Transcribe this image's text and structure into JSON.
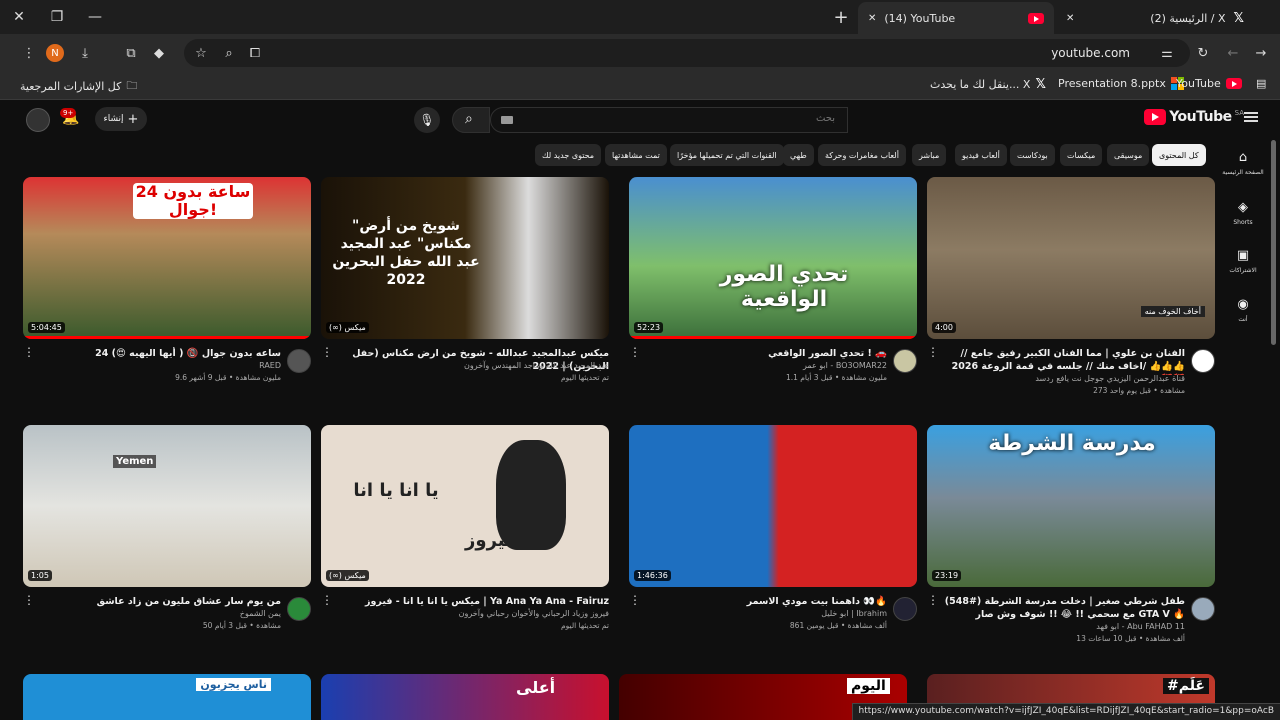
{
  "browser": {
    "tabs": [
      {
        "title": "(14) YouTube"
      },
      {
        "title": "(2) الرئيسية / X"
      }
    ],
    "url": "youtube.com",
    "profile_initial": "N",
    "bookmarks": [
      {
        "label": "YouTube"
      },
      {
        "label": "Presentation 8.pptx"
      },
      {
        "label": "ينقل لك ما يحدث... X"
      },
      {
        "label": "كل الإشارات المرجعية"
      }
    ],
    "status_url": "https://www.youtube.com/watch?v=ijfJZI_40qE&list=RDijfJZI_40qE&start_radio=1&pp=oAcB"
  },
  "youtube": {
    "region": "SA",
    "logo_text": "YouTube",
    "search_placeholder": "بحث",
    "create_label": "إنشاء",
    "notif_count": "9+",
    "chips": [
      "كل المحتوى",
      "موسيقى",
      "ميكسات",
      "بودكاست",
      "ألعاب فيديو",
      "مباشر",
      "ألعاب مغامرات وحركة",
      "طهي",
      "القنوات التي تم تحميلها مؤخرًا",
      "تمت مشاهدتها",
      "محتوى جديد لك"
    ],
    "sidebar": [
      {
        "label": "الصفحة الرئيسية",
        "icon": "home-icon"
      },
      {
        "label": "Shorts",
        "icon": "shorts-icon"
      },
      {
        "label": "الاشتراكات",
        "icon": "subscriptions-icon"
      },
      {
        "label": "أنت",
        "icon": "you-icon"
      }
    ],
    "videos": [
      {
        "title": "الفنان بن علوي | مما الفنان الكبير رفيق جامع // اخاف منك // جلسه في قمة الروعة 2026/ 👍👍👍 💯💯",
        "channel": "قناة عبدالرحمن اليزيدي جوجل نت يافع ردسد",
        "stats": "273 مشاهدة • قبل يوم واحد",
        "duration": "4:00",
        "overlay": "أخاف الخوف منه",
        "progress": 0
      },
      {
        "title": "تحدي الصور الواقعي ! 🚗",
        "channel": "ابو عمر - BO3OMAR22",
        "stats": "1.1 مليون مشاهدة • قبل 3 أيام",
        "duration": "52:23",
        "overlay": "تحدي الصور الواقعية",
        "progress": 1
      },
      {
        "title": "ميكس عبدالمجيد عبدالله - شويخ من ارض مكناس (حفل البحرين) | 2022",
        "channel": "عبد المجيد عبد الله وماجد المهندس وآخرون",
        "stats": "تم تحديثها اليوم",
        "duration": "(∞) ميكس",
        "overlay": "\"شويخ من أرض مكناس\" عبد المجيد عبد الله حفل البحرين 2022",
        "progress": 0
      },
      {
        "title": "24 ساعه بدون جوال 📵 ( أيها اليهيه 😍)",
        "channel": "RAED",
        "stats": "9.6 مليون مشاهدة • قبل 9 أشهر",
        "duration": "5:04:45",
        "overlay": "24 ساعة بدون جوال!",
        "progress": 1
      },
      {
        "title": "(548#) طفل شرطي صغير | دخلت مدرسة الشرطة مع سحمي !! 😂 !! شوف وش صار GTA V 🔥",
        "channel": "ابو فهد - Abu FAHAD 11",
        "stats": "13 ألف مشاهدة • قبل 10 ساعات",
        "duration": "23:19",
        "overlay": "مدرسة الشرطة",
        "progress": 0
      },
      {
        "title": "داهمنا بيت مودي الاسمر 👀🔥",
        "channel": "ابو خليل | Ibrahim",
        "stats": "861 ألف مشاهدة • قبل يومين",
        "duration": "1:46:36",
        "overlay": "",
        "progress": 0
      },
      {
        "title": "ميكس يا انا يا انا - فيروز | Ya Ana Ya Ana - Fairuz",
        "channel": "فيروز وزياد الرحباني والأخوان رحباني وآخرون",
        "stats": "تم تحديثها اليوم",
        "duration": "(∞) ميكس",
        "overlay": "يا انا يا انا",
        "overlay2": "فيروز",
        "progress": 0
      },
      {
        "title": "من يوم سار عشاق مليون من زاد عاشق",
        "channel": "يمن الشموخ",
        "stats": "50 مشاهدة • قبل 3 أيام",
        "duration": "1:05",
        "overlay": "Yemen",
        "progress": 0
      }
    ],
    "row3_overlays": [
      "أعلى",
      "اليوم",
      "ناس يجزبون",
      "#عَلَم"
    ]
  }
}
